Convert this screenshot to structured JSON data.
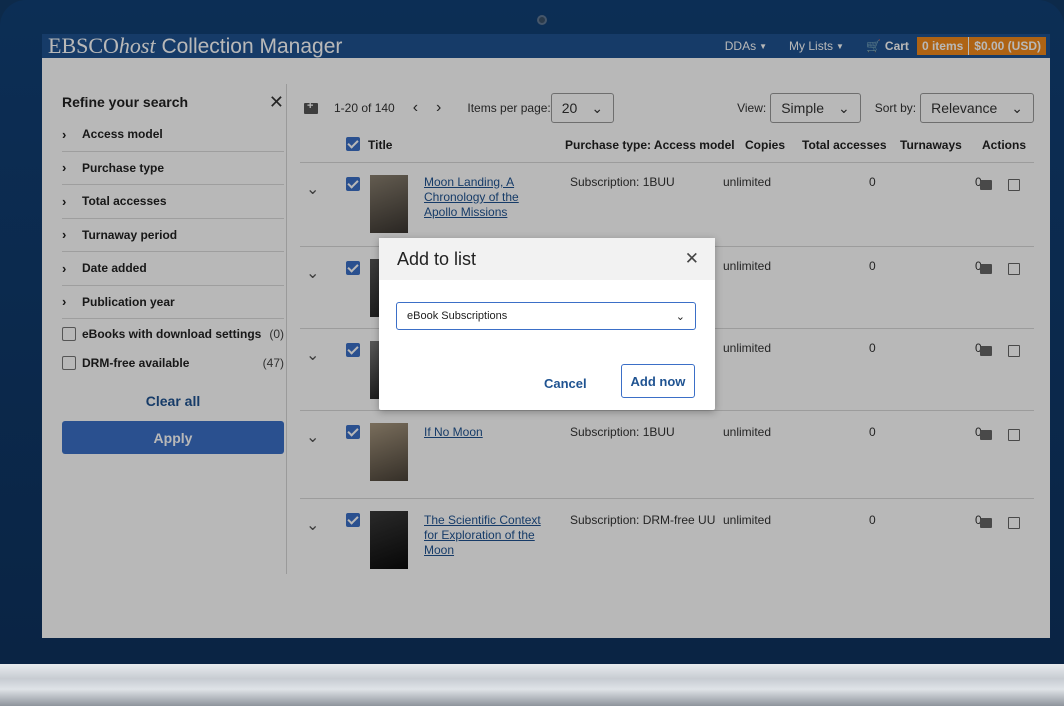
{
  "app": {
    "brand_prefix": "EBSCO",
    "brand_host": "host",
    "brand_rest": " Collection Manager"
  },
  "topnav": {
    "ddas": "DDAs",
    "mylists": "My Lists",
    "cart": "Cart",
    "items_badge": "0 items",
    "amount_badge": "$0.00 (USD)"
  },
  "sidebar": {
    "title": "Refine your search",
    "facets": [
      "Access model",
      "Purchase type",
      "Total accesses",
      "Turnaway period",
      "Date added",
      "Publication year"
    ],
    "checks": [
      {
        "label": "eBooks with download settings",
        "count": "(0)"
      },
      {
        "label": "DRM-free available",
        "count": "(47)"
      }
    ],
    "clear_all": "Clear all",
    "apply": "Apply"
  },
  "toolbar": {
    "range": "1-20 of 140",
    "items_per_page_label": "Items per page:",
    "items_per_page": "20",
    "view_label": "View:",
    "view_value": "Simple",
    "sort_label": "Sort by:",
    "sort_value": "Relevance"
  },
  "table": {
    "headers": {
      "title": "Title",
      "ptype": "Purchase type: Access model",
      "copies": "Copies",
      "total": "Total accesses",
      "turnaways": "Turnaways",
      "actions": "Actions"
    },
    "rows": [
      {
        "title": "Moon Landing, A Chronology of the Apollo Missions",
        "ptype": "Subscription: 1BUU",
        "copies": "unlimited",
        "total": "0",
        "turnaways": "0"
      },
      {
        "title": "",
        "ptype": "",
        "copies": "unlimited",
        "total": "0",
        "turnaways": "0"
      },
      {
        "title": "",
        "ptype": "",
        "copies": "unlimited",
        "total": "0",
        "turnaways": "0"
      },
      {
        "title": "If No Moon",
        "ptype": "Subscription: 1BUU",
        "copies": "unlimited",
        "total": "0",
        "turnaways": "0"
      },
      {
        "title": "The Scientific Context for Exploration of the Moon",
        "ptype": "Subscription: DRM-free UU",
        "copies": "unlimited",
        "total": "0",
        "turnaways": "0"
      }
    ]
  },
  "modal": {
    "title": "Add to list",
    "selected": "eBook Subscriptions",
    "cancel": "Cancel",
    "add_now": "Add now"
  }
}
